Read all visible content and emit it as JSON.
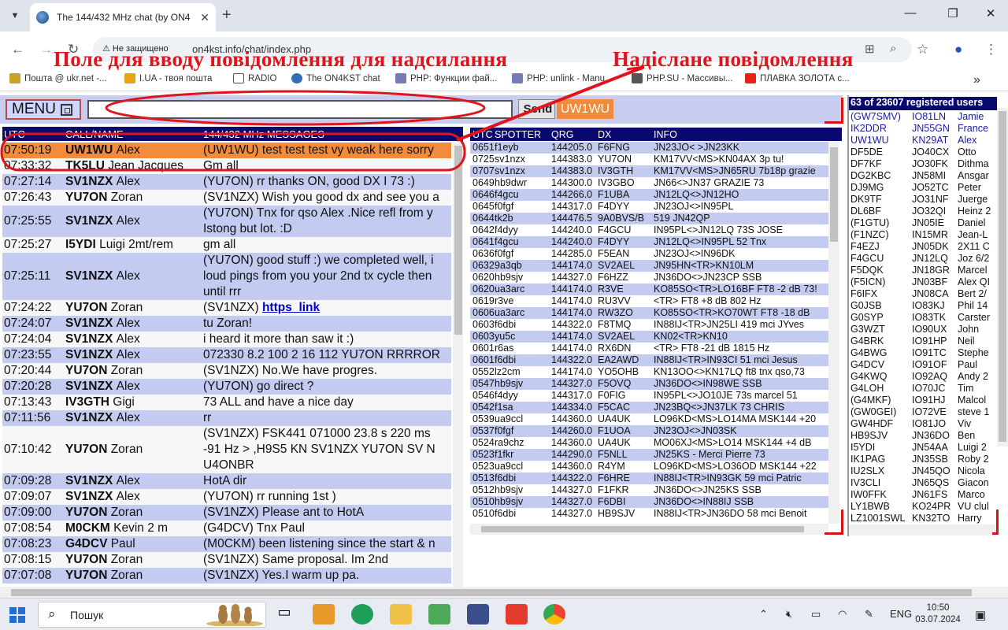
{
  "browser": {
    "tab_title": "The 144/432 MHz chat (by ON4",
    "security_label": "Не защищено",
    "url": "on4kst.info/chat/index.php",
    "bookmarks": [
      "Пошта @ ukr.net -...",
      "I.UA - твоя пошта",
      "RADIO",
      "The ON4KST chat",
      "PHP: Функции фай...",
      "PHP: unlink - Manu...",
      "PHP.SU - Массивы...",
      "ПЛАВКА ЗОЛОТА с..."
    ]
  },
  "annotations": {
    "input_caption": "Поле для вводу повідомлення для надсилання",
    "sent_caption": "Надіслане повідомлення"
  },
  "toolbar": {
    "menu_label": "MENU",
    "message_value": "",
    "send_label": "Send",
    "callsign": "UW1WU"
  },
  "chat": {
    "headers": [
      "UTC",
      "CALL/NAME",
      "144/432 MHz MESSAGES"
    ],
    "rows": [
      {
        "time": "07:50:19",
        "call": "UW1WU",
        "name": "Alex",
        "msg": [
          "(UW1WU) test test test vy weak here sorry"
        ],
        "hl": "orange"
      },
      {
        "time": "07:33:32",
        "call": "TK5LU",
        "name": "Jean Jacques",
        "msg": [
          "Gm all"
        ],
        "hl": "white"
      },
      {
        "time": "07:27:14",
        "call": "SV1NZX",
        "name": "Alex",
        "msg": [
          "(YU7ON) rr thanks ON, good DX I 73 :)"
        ],
        "hl": "blue"
      },
      {
        "time": "07:26:43",
        "call": "YU7ON",
        "name": "Zoran",
        "msg": [
          "(SV1NZX) Wish you good dx and see you a"
        ],
        "hl": "white"
      },
      {
        "time": "07:25:55",
        "call": "SV1NZX",
        "name": "Alex",
        "msg": [
          "(YU7ON) Tnx for qso Alex .Nice refl from y",
          "Istong but lot. :D"
        ],
        "hl": "blue"
      },
      {
        "time": "07:25:27",
        "call": "I5YDI",
        "name": "Luigi 2mt/rem",
        "msg": [
          "gm all"
        ],
        "hl": "white"
      },
      {
        "time": "07:25:11",
        "call": "SV1NZX",
        "name": "Alex",
        "msg": [
          "(YU7ON) good stuff :) we completed well, i",
          "loud pings from you your 2nd tx cycle then",
          "until rrr"
        ],
        "hl": "blue"
      },
      {
        "time": "07:24:22",
        "call": "YU7ON",
        "name": "Zoran",
        "msg": [
          "(SV1NZX) "
        ],
        "link": "https_link",
        "hl": "white"
      },
      {
        "time": "07:24:07",
        "call": "SV1NZX",
        "name": "Alex",
        "msg": [
          "tu Zoran!"
        ],
        "hl": "blue"
      },
      {
        "time": "07:24:04",
        "call": "SV1NZX",
        "name": "Alex",
        "msg": [
          "i heard it more than saw it :)"
        ],
        "hl": "white"
      },
      {
        "time": "07:23:55",
        "call": "SV1NZX",
        "name": "Alex",
        "msg": [
          "072330 8.2 100 2 16 112 YU7ON RRRROR"
        ],
        "hl": "blue"
      },
      {
        "time": "07:20:44",
        "call": "YU7ON",
        "name": "Zoran",
        "msg": [
          "(SV1NZX) No.We have progres."
        ],
        "hl": "white"
      },
      {
        "time": "07:20:28",
        "call": "SV1NZX",
        "name": "Alex",
        "msg": [
          "(YU7ON) go direct ?"
        ],
        "hl": "blue"
      },
      {
        "time": "07:13:43",
        "call": "IV3GTH",
        "name": "Gigi",
        "msg": [
          "73 ALL and have a nice day"
        ],
        "hl": "white"
      },
      {
        "time": "07:11:56",
        "call": "SV1NZX",
        "name": "Alex",
        "msg": [
          "rr"
        ],
        "hl": "blue"
      },
      {
        "time": "07:10:42",
        "call": "YU7ON",
        "name": "Zoran",
        "msg": [
          "(SV1NZX) FSK441 071000 23.8 s 220 ms",
          "-91 Hz > ,H9S5 KN SV1NZX YU7ON SV N",
          "U4ONBR"
        ],
        "hl": "white"
      },
      {
        "time": "07:09:28",
        "call": "SV1NZX",
        "name": "Alex",
        "msg": [
          "HotA dir"
        ],
        "hl": "blue"
      },
      {
        "time": "07:09:07",
        "call": "SV1NZX",
        "name": "Alex",
        "msg": [
          "(YU7ON) rr running 1st )"
        ],
        "hl": "white"
      },
      {
        "time": "07:09:00",
        "call": "YU7ON",
        "name": "Zoran",
        "msg": [
          "(SV1NZX) Please ant to HotA"
        ],
        "hl": "blue"
      },
      {
        "time": "07:08:54",
        "call": "M0CKM",
        "name": "Kevin 2 m",
        "msg": [
          "(G4DCV) Tnx Paul"
        ],
        "hl": "white"
      },
      {
        "time": "07:08:23",
        "call": "G4DCV",
        "name": "Paul",
        "msg": [
          "(M0CKM) been listening since the start & n"
        ],
        "hl": "blue"
      },
      {
        "time": "07:08:15",
        "call": "YU7ON",
        "name": "Zoran",
        "msg": [
          "(SV1NZX) Same proposal. Im 2nd"
        ],
        "hl": "white"
      },
      {
        "time": "07:07:08",
        "call": "YU7ON",
        "name": "Zoran",
        "msg": [
          "(SV1NZX) Yes.I warm up pa."
        ],
        "hl": "blue"
      }
    ]
  },
  "dx": {
    "headers": [
      "UTC",
      "SPOTTER",
      "QRG",
      "DX",
      "INFO"
    ],
    "rows": [
      [
        "0651",
        "f1eyb",
        "144205.0",
        "F6FNG",
        "JN23JO< >JN23KK"
      ],
      [
        "0725",
        "sv1nzx",
        "144383.0",
        "YU7ON",
        "KM17VV<MS>KN04AX 3p tu!"
      ],
      [
        "0707",
        "sv1nzx",
        "144383.0",
        "IV3GTH",
        "KM17VV<MS>JN65RU 7b18p grazie"
      ],
      [
        "0649",
        "hb9dwr",
        "144300.0",
        "IV3GBO",
        "JN66<>JN37 GRAZIE 73"
      ],
      [
        "0646",
        "f4gcu",
        "144266.0",
        "F1UBA",
        "JN12LQ<>JN12HO"
      ],
      [
        "0645",
        "f0fgf",
        "144317.0",
        "F4DYY",
        "JN23OJ<>IN95PL"
      ],
      [
        "0644",
        "tk2b",
        "144476.5",
        "9A0BVS/B",
        "519 JN42QP"
      ],
      [
        "0642",
        "f4dyy",
        "144240.0",
        "F4GCU",
        "IN95PL<>JN12LQ 73S JOSE"
      ],
      [
        "0641",
        "f4gcu",
        "144240.0",
        "F4DYY",
        "JN12LQ<>IN95PL 52 Tnx"
      ],
      [
        "0636",
        "f0fgf",
        "144285.0",
        "F5EAN",
        "JN23OJ<>IN96DK"
      ],
      [
        "0632",
        "9a3qb",
        "144174.0",
        "SV2AEL",
        "JN95HN<TR>KN10LM"
      ],
      [
        "0620",
        "hb9sjv",
        "144327.0",
        "F6HZZ",
        "JN36DO<>JN23CP SSB"
      ],
      [
        "0620",
        "ua3arc",
        "144174.0",
        "R3VE",
        "KO85SO<TR>LO16BF FT8 -2 dB 73!"
      ],
      [
        "0619",
        "r3ve",
        "144174.0",
        "RU3VV",
        "<TR> FT8 +8 dB 802 Hz"
      ],
      [
        "0606",
        "ua3arc",
        "144174.0",
        "RW3ZO",
        "KO85SO<TR>KO70WT FT8 -18 dB"
      ],
      [
        "0603",
        "f6dbi",
        "144322.0",
        "F8TMQ",
        "IN88IJ<TR>JN25LI 419 mci JYves"
      ],
      [
        "0603",
        "yu5c",
        "144174.0",
        "SV2AEL",
        "KN02<TR>KN10"
      ],
      [
        "0601",
        "r6as",
        "144174.0",
        "RX6DN",
        "<TR> FT8 -21 dB 1815 Hz"
      ],
      [
        "0601",
        "f6dbi",
        "144322.0",
        "EA2AWD",
        "IN88IJ<TR>IN93CI 51 mci Jesus"
      ],
      [
        "0552",
        "lz2cm",
        "144174.0",
        "YO5OHB",
        "KN13OO<>KN17LQ ft8 tnx qso,73"
      ],
      [
        "0547",
        "hb9sjv",
        "144327.0",
        "F5OVQ",
        "JN36DO<>IN98WE SSB"
      ],
      [
        "0546",
        "f4dyy",
        "144317.0",
        "F0FIG",
        "IN95PL<>JO10JE 73s marcel 51"
      ],
      [
        "0542",
        "f1sa",
        "144334.0",
        "F5CAC",
        "JN23BQ<>JN37LK 73 CHRIS"
      ],
      [
        "0539",
        "ua9ccl",
        "144360.0",
        "UA4UK",
        "LO96KD<MS>LO14MA MSK144 +20"
      ],
      [
        "0537",
        "f0fgf",
        "144260.0",
        "F1UOA",
        "JN23OJ<>JN03SK"
      ],
      [
        "0524",
        "ra9chz",
        "144360.0",
        "UA4UK",
        "MO06XJ<MS>LO14 MSK144 +4 dB"
      ],
      [
        "0523",
        "f1fkr",
        "144290.0",
        "F5NLL",
        "JN25KS - Merci Pierre 73"
      ],
      [
        "0523",
        "ua9ccl",
        "144360.0",
        "R4YM",
        "LO96KD<MS>LO36OD MSK144 +22"
      ],
      [
        "0513",
        "f6dbi",
        "144322.0",
        "F6HRE",
        "IN88IJ<TR>IN93GK 59 mci Patric"
      ],
      [
        "0512",
        "hb9sjv",
        "144327.0",
        "F1FKR",
        "JN36DO<>JN25KS SSB"
      ],
      [
        "0510",
        "hb9sjv",
        "144327.0",
        "F6DBI",
        "JN36DO<>IN88IJ SSB"
      ],
      [
        "0510",
        "f6dbi",
        "144327.0",
        "HB9SJV",
        "IN88IJ<TR>JN36DO 58 mci Benoit"
      ]
    ]
  },
  "users": {
    "header": "63 of 23607 registered users",
    "rows": [
      [
        "(GW7SMV)",
        "IO81LN",
        "Jamie",
        "blue"
      ],
      [
        "IK2DDR",
        "JN55GN",
        "France",
        "blue"
      ],
      [
        "UW1WU",
        "KN29AT",
        "Alex",
        "blue"
      ],
      [
        "DF5DE",
        "JO40CX",
        "Otto",
        "black"
      ],
      [
        "DF7KF",
        "JO30FK",
        "Dithma",
        "black"
      ],
      [
        "DG2KBC",
        "JN58MI",
        "Ansgar",
        "black"
      ],
      [
        "DJ9MG",
        "JO52TC",
        "Peter",
        "black"
      ],
      [
        "DK9TF",
        "JO31NF",
        "Juerge",
        "black"
      ],
      [
        "DL6BF",
        "JO32QI",
        "Heinz 2",
        "black"
      ],
      [
        "(F1GTU)",
        "JN05IE",
        "Daniel",
        "black"
      ],
      [
        "(F1NZC)",
        "IN15MR",
        "Jean-L",
        "black"
      ],
      [
        "F4EZJ",
        "JN05DK",
        "2X11 C",
        "black"
      ],
      [
        "F4GCU",
        "JN12LQ",
        "Joz 6/2",
        "black"
      ],
      [
        "F5DQK",
        "JN18GR",
        "Marcel",
        "black"
      ],
      [
        "(F5ICN)",
        "JN03BF",
        "Alex QI",
        "black"
      ],
      [
        "F6IFX",
        "JN08CA",
        "Bert 2/",
        "black"
      ],
      [
        "G0JSB",
        "IO83KJ",
        "Phil 14",
        "black"
      ],
      [
        "G0SYP",
        "IO83TK",
        "Carster",
        "black"
      ],
      [
        "G3WZT",
        "IO90UX",
        "John",
        "black"
      ],
      [
        "G4BRK",
        "IO91HP",
        "Neil",
        "black"
      ],
      [
        "G4BWG",
        "IO91TC",
        "Stephe",
        "black"
      ],
      [
        "G4DCV",
        "IO91OF",
        "Paul",
        "black"
      ],
      [
        "G4KWQ",
        "IO92AQ",
        "Andy 2",
        "black"
      ],
      [
        "G4LOH",
        "IO70JC",
        "Tim",
        "black"
      ],
      [
        "(G4MKF)",
        "IO91HJ",
        "Malcol",
        "black"
      ],
      [
        "(GW0GEI)",
        "IO72VE",
        "steve 1",
        "black"
      ],
      [
        "GW4HDF",
        "IO81JO",
        "Viv",
        "black"
      ],
      [
        "HB9SJV",
        "JN36DO",
        "Ben",
        "black"
      ],
      [
        "I5YDI",
        "JN54AA",
        "Luigi 2",
        "black"
      ],
      [
        "IK1PAG",
        "JN35SB",
        "Roby 2",
        "black"
      ],
      [
        "IU2SLX",
        "JN45QO",
        "Nicola",
        "black"
      ],
      [
        "IV3CLI",
        "JN65QS",
        "Giacon",
        "black"
      ],
      [
        "IW0FFK",
        "JN61FS",
        "Marco",
        "black"
      ],
      [
        "LY1BWB",
        "KO24PR",
        "VU clul",
        "black"
      ],
      [
        "LZ1001SWL",
        "KN32TO",
        "Harry",
        "black"
      ]
    ]
  },
  "taskbar": {
    "search_placeholder": "Пошук",
    "lang": "ENG",
    "time": "10:50",
    "date": "03.07.2024"
  }
}
